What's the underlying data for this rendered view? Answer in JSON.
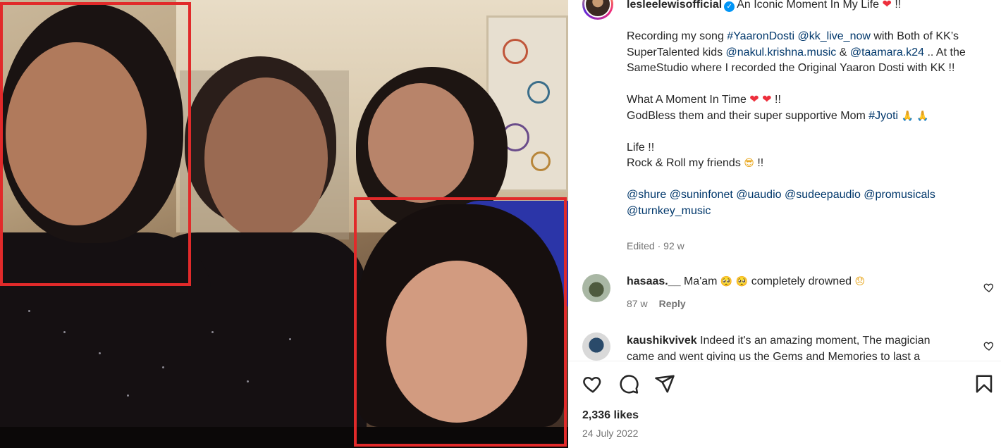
{
  "post": {
    "username": "lesleelewisofficial",
    "verified": true,
    "caption_line1": "An Iconic Moment In My Life",
    "caption_line1_suffix": " !!",
    "para1_a": "Recording my song ",
    "tag_yaarondosti": "#YaaronDosti",
    "mention_kk": "@kk_live_now",
    "para1_b": " with Both of KK’s SuperTalented kids ",
    "mention_nakul": "@nakul.krishna.music",
    "para1_c": " & ",
    "mention_taamara": "@taamara.k24",
    "para1_d": " .. At the SameStudio where I recorded the Original Yaaron Dosti with KK !!",
    "para2_a": "What A Moment In Time ",
    "para2_suffix": " !!",
    "para3_a": "GodBless them and their super supportive Mom ",
    "tag_jyoti": "#Jyoti",
    "para4_a": "Life !!",
    "para5_a": "Rock & Roll my friends ",
    "para5_suffix": " !!",
    "mentions_line1": "@shure @suninfonet @uaudio @sudeepaudio @promusicals",
    "mentions_line2": "@turnkey_music",
    "edited_label": "Edited",
    "edited_sep": " · ",
    "edited_time": "92 w"
  },
  "comments": [
    {
      "username": "hasaas.__",
      "text_a": " Ma'am ",
      "text_b": " completely drowned ",
      "time": "87 w",
      "reply_label": "Reply"
    },
    {
      "username": "kaushikvivek",
      "text": " Indeed it's an amazing moment, The magician came and went giving us the Gems and Memories to last a"
    }
  ],
  "footer": {
    "likes": "2,336 likes",
    "date": "24 July 2022"
  },
  "icons": {
    "like": "heart-outline-icon",
    "comment": "comment-bubble-icon",
    "share": "paper-plane-icon",
    "save": "bookmark-icon"
  },
  "colors": {
    "link": "#00376b",
    "verified": "#0095f6",
    "highlight_box": "#e12a2a",
    "meta": "#737373"
  }
}
